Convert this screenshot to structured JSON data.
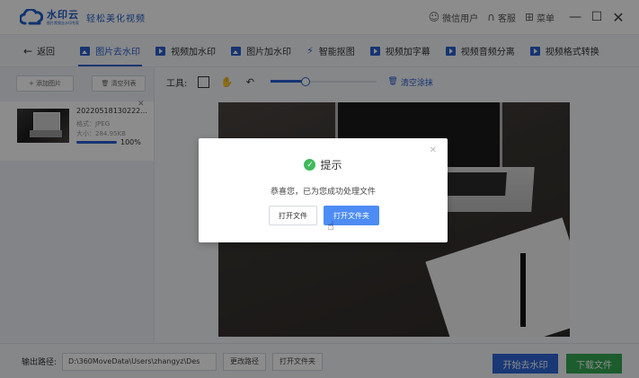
{
  "app": {
    "logo_name": "水印云",
    "logo_sub": "图片视频去水印专家",
    "slogan": "轻松美化视频"
  },
  "titlebar": {
    "user_label": "微信用户",
    "service_label": "客服",
    "menu_label": "菜单"
  },
  "nav": {
    "back_label": "返回",
    "tabs": [
      {
        "label": "图片去水印",
        "icon": "image-icon",
        "active": true
      },
      {
        "label": "视频加水印",
        "icon": "video-icon",
        "active": false
      },
      {
        "label": "图片加水印",
        "icon": "image-icon",
        "active": false
      },
      {
        "label": "智能抠图",
        "icon": "magic-wand-icon",
        "active": false
      },
      {
        "label": "视频加字幕",
        "icon": "video-icon",
        "active": false
      },
      {
        "label": "视频音频分离",
        "icon": "video-icon",
        "active": false
      },
      {
        "label": "视频格式转换",
        "icon": "video-icon",
        "active": false
      }
    ]
  },
  "sidebar": {
    "add_label": "添加图片",
    "clear_label": "清空列表",
    "file": {
      "name": "20220518130222...",
      "format": "格式：JPEG",
      "size": "大小：284.95KB",
      "progress": 1.0,
      "progress_text": "100%"
    }
  },
  "toolbar": {
    "label": "工具:",
    "clear_all_label": "清空涂抹",
    "brush_level": 0.33
  },
  "dialog": {
    "title": "提示",
    "message": "恭喜您，已为您成功处理文件",
    "open_file_label": "打开文件",
    "open_folder_label": "打开文件夹"
  },
  "bottom": {
    "output_label": "输出路径:",
    "output_path": "D:\\360MoveData\\Users\\zhangyz\\Des",
    "change_path_label": "更改路径",
    "open_folder_label": "打开文件夹",
    "start_label": "开始去水印",
    "download_label": "下载文件"
  },
  "colors": {
    "accent": "#2b5fd0",
    "success": "#3fba5b",
    "download": "#34a853"
  }
}
